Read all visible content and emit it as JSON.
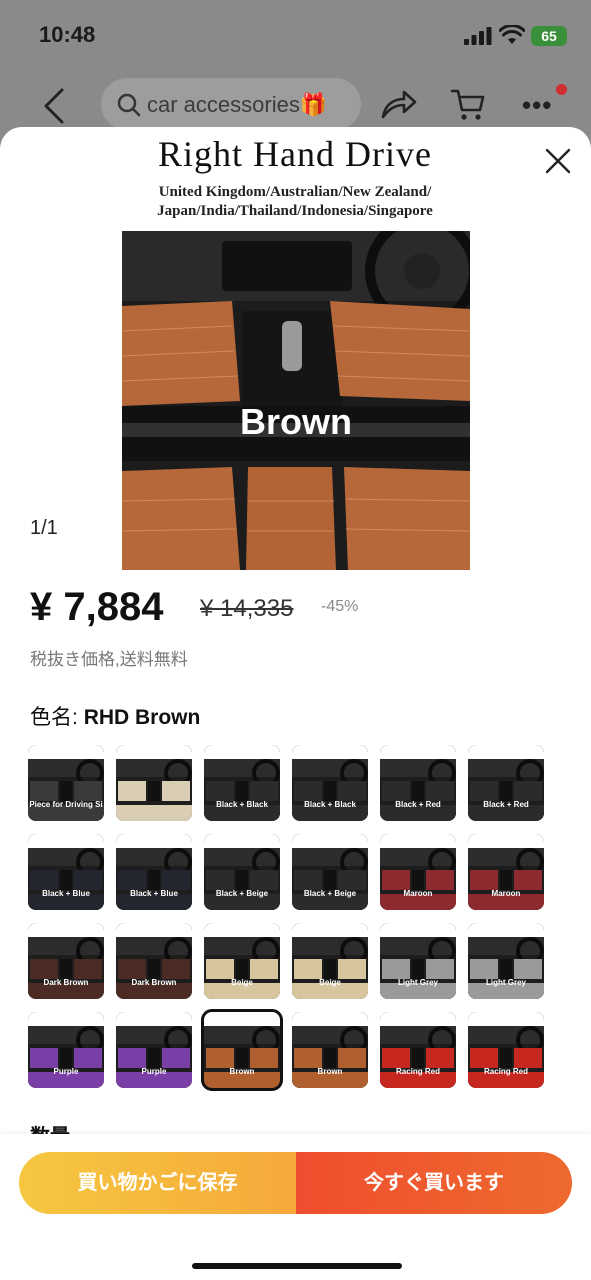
{
  "status": {
    "time": "10:48",
    "battery": "65"
  },
  "nav": {
    "search_text": "car accessories🎁"
  },
  "hero": {
    "title": "Right Hand Drive",
    "subtitle_line1": "United Kingdom/Australian/New Zealand/",
    "subtitle_line2": "Japan/India/Thailand/Indonesia/Singapore",
    "label": "Brown",
    "counter": "1/1"
  },
  "price": {
    "current": "¥ 7,884",
    "original": "¥ 14,335",
    "discount": "-45%",
    "note": "税抜き価格,送料無料"
  },
  "color": {
    "label": "色名:",
    "value": "RHD Brown"
  },
  "variants": [
    {
      "caption": "Piece for Driving Si",
      "mat": "#3a3a3a"
    },
    {
      "caption": "",
      "mat": "#d9cdb3"
    },
    {
      "caption": "Black + Black",
      "mat": "#2b2b2b"
    },
    {
      "caption": "Black + Black",
      "mat": "#2b2b2b"
    },
    {
      "caption": "Black + Red",
      "mat": "#2b2b2b"
    },
    {
      "caption": "Black + Red",
      "mat": "#2b2b2b"
    },
    {
      "caption": "Black + Blue",
      "mat": "#23262e"
    },
    {
      "caption": "Black + Blue",
      "mat": "#23262e"
    },
    {
      "caption": "Black + Beige",
      "mat": "#2b2b2b"
    },
    {
      "caption": "Black + Beige",
      "mat": "#2b2b2b"
    },
    {
      "caption": "Maroon",
      "mat": "#8d2a2f"
    },
    {
      "caption": "Maroon",
      "mat": "#8d2a2f"
    },
    {
      "caption": "Dark Brown",
      "mat": "#4b2b24"
    },
    {
      "caption": "Dark Brown",
      "mat": "#4b2b24"
    },
    {
      "caption": "Beige",
      "mat": "#d7c59e"
    },
    {
      "caption": "Beige",
      "mat": "#d7c59e"
    },
    {
      "caption": "Light Grey",
      "mat": "#9a9a9a"
    },
    {
      "caption": "Light Grey",
      "mat": "#9a9a9a"
    },
    {
      "caption": "Purple",
      "mat": "#7a3fa7"
    },
    {
      "caption": "Purple",
      "mat": "#7a3fa7"
    },
    {
      "caption": "Brown",
      "mat": "#b0602e"
    },
    {
      "caption": "Brown",
      "mat": "#b0602e"
    },
    {
      "caption": "Racing Red",
      "mat": "#c6271f"
    },
    {
      "caption": "Racing Red",
      "mat": "#c6271f"
    }
  ],
  "selected_variant": 20,
  "quantity_label": "数量",
  "actions": {
    "save": "買い物かごに保存",
    "buy": "今すぐ買います"
  }
}
